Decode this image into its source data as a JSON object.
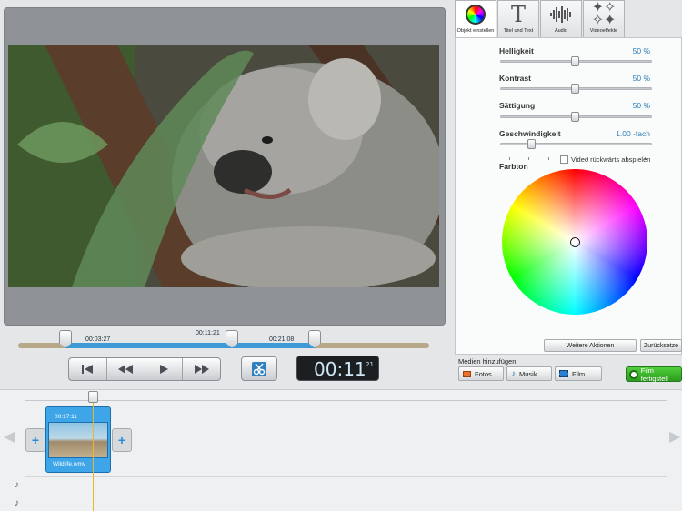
{
  "tabs": [
    {
      "label": "Objekt einstellen",
      "icon": "color-wheel-icon"
    },
    {
      "label": "Titel und Text",
      "icon": "text-T-icon"
    },
    {
      "label": "Audio",
      "icon": "audio-waveform-icon"
    },
    {
      "label": "Videoeffekte",
      "icon": "sparkle-icon"
    }
  ],
  "properties": {
    "brightness_label": "Helligkeit",
    "brightness_value": "50 %",
    "brightness_level": 0.5,
    "contrast_label": "Kontrast",
    "contrast_value": "50 %",
    "contrast_level": 0.5,
    "saturation_label": "Sättigung",
    "saturation_value": "50 %",
    "saturation_level": 0.5,
    "speed_label": "Geschwindigkeit",
    "speed_value": "1.00 -fach",
    "reverse_label": "Video rückwärts abspielen",
    "hue_label": "Farbton"
  },
  "buttons": {
    "more_actions": "Weitere Aktionen",
    "reset": "Zurücksetze",
    "finish": "Film fertigstell"
  },
  "media": {
    "label": "Medien hinzufügen:",
    "photos": "Fotos",
    "music": "Musik",
    "film": "Film"
  },
  "scrubber": {
    "start": "00:03:27",
    "current": "00:11:21",
    "end": "00:21:08"
  },
  "time_display": {
    "main": "00:11",
    "frames": "21"
  },
  "clip": {
    "duration": "00:17:11",
    "filename": "Wildlife.wmv"
  },
  "colors": {
    "accent": "#3d9ad6",
    "value_text": "#2c7fb8",
    "finish_green": "#2d9b1f"
  }
}
